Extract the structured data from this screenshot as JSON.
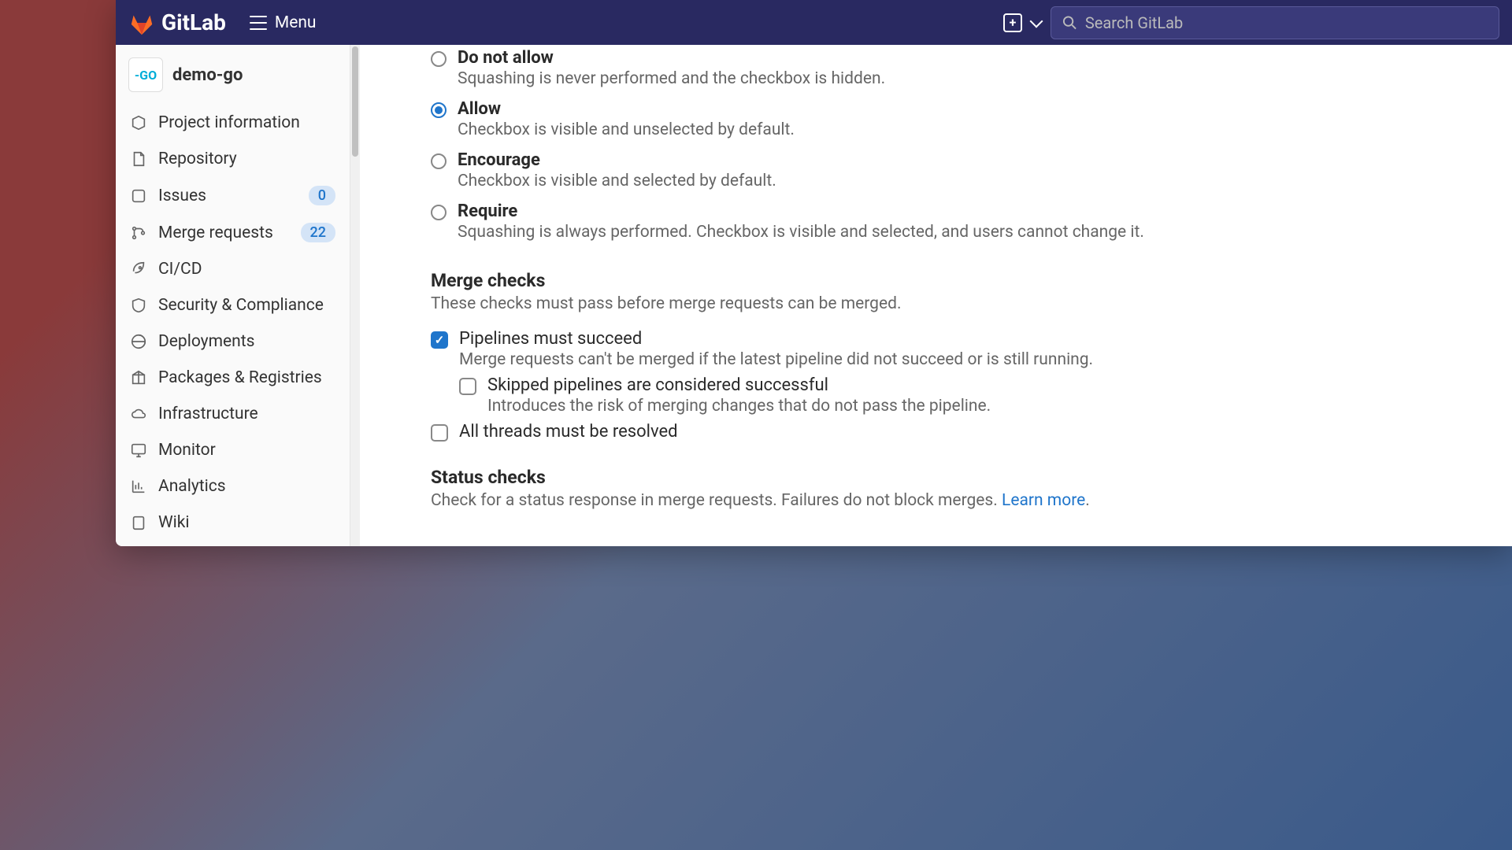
{
  "header": {
    "brand": "GitLab",
    "menu": "Menu",
    "search_placeholder": "Search GitLab"
  },
  "project": {
    "name": "demo-go",
    "avatar_text": "-GO"
  },
  "sidebar": {
    "items": [
      {
        "label": "Project information"
      },
      {
        "label": "Repository"
      },
      {
        "label": "Issues",
        "badge": "0"
      },
      {
        "label": "Merge requests",
        "badge": "22"
      },
      {
        "label": "CI/CD"
      },
      {
        "label": "Security & Compliance"
      },
      {
        "label": "Deployments"
      },
      {
        "label": "Packages & Registries"
      },
      {
        "label": "Infrastructure"
      },
      {
        "label": "Monitor"
      },
      {
        "label": "Analytics"
      },
      {
        "label": "Wiki"
      }
    ]
  },
  "squash": {
    "options": [
      {
        "title": "Do not allow",
        "desc": "Squashing is never performed and the checkbox is hidden.",
        "selected": false
      },
      {
        "title": "Allow",
        "desc": "Checkbox is visible and unselected by default.",
        "selected": true
      },
      {
        "title": "Encourage",
        "desc": "Checkbox is visible and selected by default.",
        "selected": false
      },
      {
        "title": "Require",
        "desc": "Squashing is always performed. Checkbox is visible and selected, and users cannot change it.",
        "selected": false
      }
    ]
  },
  "merge_checks": {
    "title": "Merge checks",
    "desc": "These checks must pass before merge requests can be merged.",
    "pipelines": {
      "title": "Pipelines must succeed",
      "desc": "Merge requests can't be merged if the latest pipeline did not succeed or is still running.",
      "checked": true
    },
    "skipped": {
      "title": "Skipped pipelines are considered successful",
      "desc": "Introduces the risk of merging changes that do not pass the pipeline.",
      "checked": false
    },
    "threads": {
      "title": "All threads must be resolved",
      "checked": false
    }
  },
  "status_checks": {
    "title": "Status checks",
    "desc": "Check for a status response in merge requests. Failures do not block merges. ",
    "learn_more": "Learn more"
  }
}
